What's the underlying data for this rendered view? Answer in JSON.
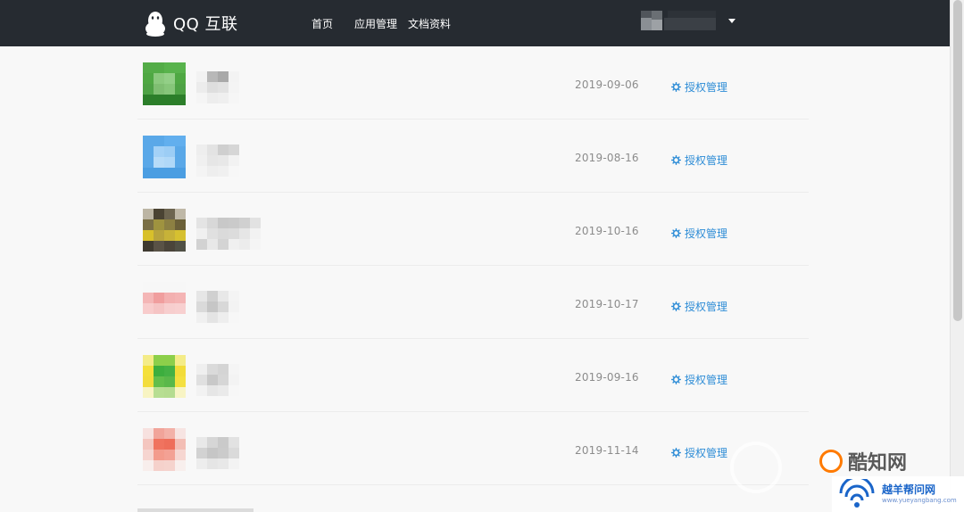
{
  "header": {
    "brand": "QQ 互联",
    "nav": [
      "首页",
      "应用管理",
      "文档资料"
    ]
  },
  "apps": [
    {
      "date": "2019-09-06",
      "manage_label": "授权管理",
      "avatar": [
        "#53ac47",
        "#53ac47",
        "#58b34c",
        "#58b34c",
        "#4fa843",
        "#8bc97e",
        "#93cf87",
        "#4fa843",
        "#4ea245",
        "#7fbe72",
        "#87c67a",
        "#4ea245",
        "#2c7e2a",
        "#2c7e2a",
        "#2c7e2a",
        "#2c7e2a"
      ],
      "name": [
        "#f2f2f2",
        "#b8b8b8",
        "#a9a9a9",
        "#f3f3f3",
        "#ececec",
        "#dedede",
        "#e2e2e2",
        "#f4f4f4",
        "#f5f5f5",
        "#ededed",
        "#efefef",
        "#f6f6f6"
      ]
    },
    {
      "date": "2019-08-16",
      "manage_label": "授权管理",
      "avatar": [
        "#5aa8e8",
        "#5aa8e8",
        "#62afee",
        "#62afee",
        "#5aa8e8",
        "#a3d1f7",
        "#9ccdf5",
        "#5aa8e8",
        "#5aa8e8",
        "#b6dbf8",
        "#b0d8f8",
        "#5aa8e8",
        "#4b9ee2",
        "#4b9ee2",
        "#4b9ee2",
        "#4b9ee2"
      ],
      "name": [
        "#eeeeee",
        "#e3e3e3",
        "#cfcfcf",
        "#d6d6d6",
        "#f0f0f0",
        "#e6e6e6",
        "#e8e8e8",
        "#f2f2f2",
        "#f4f4f4",
        "#eeeeee",
        "#f0f0f0",
        "#f7f7f7"
      ]
    },
    {
      "date": "2019-10-16",
      "manage_label": "授权管理",
      "avatar": [
        "#bcb5a4",
        "#4a4333",
        "#6d6550",
        "#bfb8a7",
        "#7a6f45",
        "#9f933f",
        "#8c8042",
        "#6b6038",
        "#d8c02a",
        "#b8a43c",
        "#c7b238",
        "#d6c030",
        "#3f3a30",
        "#595246",
        "#4a443a",
        "#505045"
      ],
      "name": [
        "#e4e4e4",
        "#d8d8d8",
        "#c8c8c8",
        "#cacaca",
        "#d0d0d0",
        "#e2e2e2",
        "#f0f0f0",
        "#e0e0e0",
        "#dadada",
        "#dcdcdc",
        "#e6e6e6",
        "#f2f2f2"
      ],
      "wide": true
    },
    {
      "date": "2019-10-17",
      "manage_label": "授权管理",
      "avatar": [
        "#f7f7f7",
        "#f7f7f7",
        "#f7f7f7",
        "#f7f7f7",
        "#f4b6b6",
        "#f09e9e",
        "#f3b0b0",
        "#f4b4b4",
        "#f8cccc",
        "#f5c4c4",
        "#f7cece",
        "#f8d0d0",
        "#f8f8f8",
        "#f8f8f8",
        "#f8f8f8",
        "#f8f8f8"
      ],
      "name": [
        "#e6e6e6",
        "#d0d0d0",
        "#e8e8e8",
        "#f4f4f4",
        "#dadada",
        "#c6c6c6",
        "#d8d8d8",
        "#f3f3f3",
        "#f0f0f0",
        "#e4e4e4",
        "#eeeeee",
        "#f7f7f7"
      ]
    },
    {
      "date": "2019-09-16",
      "manage_label": "授权管理",
      "avatar": [
        "#f4ec88",
        "#8ccf4a",
        "#8ccf4a",
        "#f4ec88",
        "#f4e03b",
        "#3cae3e",
        "#44b144",
        "#f2dc3a",
        "#f3dd3c",
        "#62be4b",
        "#5ab84a",
        "#f4e040",
        "#f8f4c2",
        "#b7de92",
        "#b5dc90",
        "#f8f4c4"
      ],
      "name": [
        "#efefef",
        "#dadada",
        "#d4d4d4",
        "#f5f5f5",
        "#e0e0e0",
        "#c8c8c8",
        "#d6d6d6",
        "#f3f3f3",
        "#f2f2f2",
        "#e6e6e6",
        "#eaeaea",
        "#f7f7f7"
      ]
    },
    {
      "date": "2019-11-14",
      "manage_label": "授权管理",
      "avatar": [
        "#f7e1df",
        "#f1a49a",
        "#f3b1a8",
        "#f7e4e2",
        "#f4c6bf",
        "#f0735f",
        "#ee6e5a",
        "#f3beb5",
        "#f6d5d0",
        "#f39b8c",
        "#f3a194",
        "#f6d6d1",
        "#f8eeec",
        "#f5d1cb",
        "#f5d3cd",
        "#f8efed"
      ],
      "name": [
        "#e8e8e8",
        "#d6d6d6",
        "#cacaca",
        "#e2e2e2",
        "#d2d2d2",
        "#c6c6c6",
        "#cbcbcb",
        "#dadada",
        "#ededed",
        "#e5e5e5",
        "#e8e8e8",
        "#f3f3f3"
      ]
    }
  ],
  "watermark": {
    "site_name": "酷知网",
    "site_name_2": "越羊帮问网",
    "site_url": "www.yueyangbang.com"
  }
}
